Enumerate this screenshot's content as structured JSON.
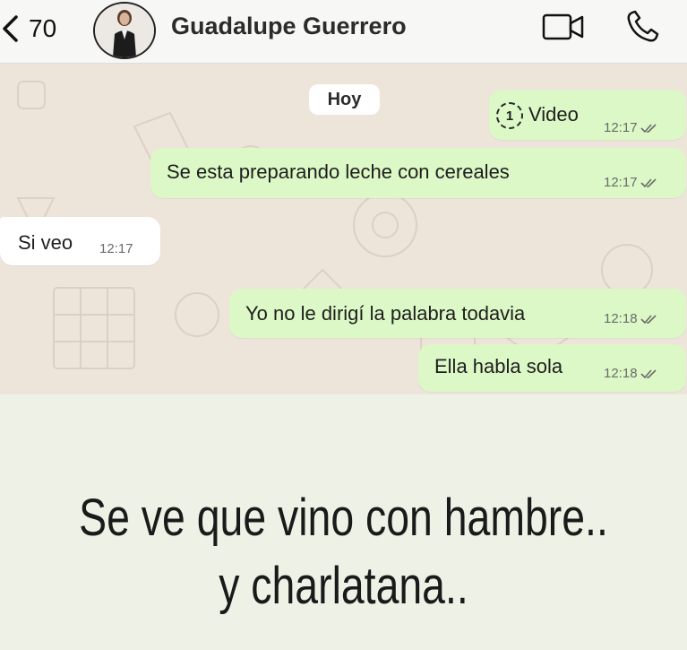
{
  "header": {
    "back_count": "70",
    "contact_name": "Guadalupe Guerrero",
    "icons": [
      "chevron-left-icon",
      "video-call-icon",
      "phone-icon"
    ]
  },
  "chat": {
    "day_label": "Hoy",
    "messages": [
      {
        "direction": "out",
        "kind": "video",
        "view_once_label": "1",
        "text": "Video",
        "time": "12:17",
        "status": "read"
      },
      {
        "direction": "out",
        "text": "Se esta preparando leche con cereales",
        "time": "12:17",
        "status": "read"
      },
      {
        "direction": "in",
        "text": "Si veo",
        "time": "12:17"
      },
      {
        "direction": "out",
        "text": "Yo no le dirigí la palabra todavia",
        "time": "12:18",
        "status": "read"
      },
      {
        "direction": "out",
        "text": "Ella habla sola",
        "time": "12:18",
        "status": "read"
      }
    ]
  },
  "caption": {
    "line1": "Se ve que vino con hambre..",
    "line2": "y charlatana.."
  },
  "colors": {
    "outgoing_bubble": "#dcf8c6",
    "incoming_bubble": "#ffffff",
    "chat_background": "#ede5da",
    "caption_background": "#eef2e6"
  }
}
